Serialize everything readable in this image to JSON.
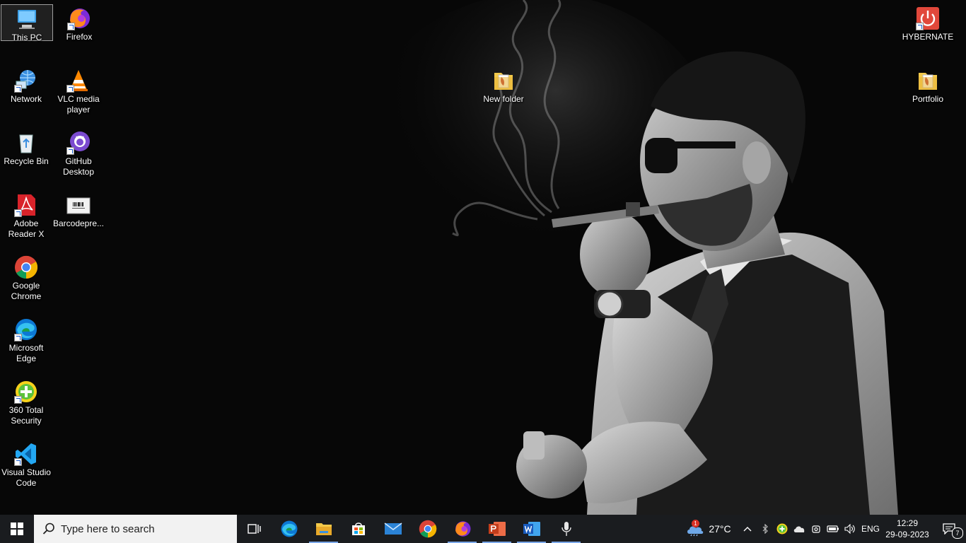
{
  "desktop": {
    "icons_col1": [
      {
        "label": "This PC",
        "icon": "computer-icon"
      },
      {
        "label": "Network",
        "icon": "network-icon"
      },
      {
        "label": "Recycle Bin",
        "icon": "recycle-bin-icon"
      },
      {
        "label": "Adobe Reader X",
        "icon": "adobe-reader-icon"
      },
      {
        "label": "Google Chrome",
        "icon": "chrome-icon"
      },
      {
        "label": "Microsoft Edge",
        "icon": "edge-icon"
      },
      {
        "label": "360 Total Security",
        "icon": "360-security-icon"
      },
      {
        "label": "Visual Studio Code",
        "icon": "vscode-icon"
      }
    ],
    "icons_col2": [
      {
        "label": "Firefox",
        "icon": "firefox-icon"
      },
      {
        "label": "VLC media player",
        "icon": "vlc-icon"
      },
      {
        "label": "GitHub Desktop",
        "icon": "github-desktop-icon"
      },
      {
        "label": "Barcodepre...",
        "icon": "barcode-file-icon"
      }
    ],
    "new_folder": {
      "label": "New folder",
      "icon": "folder-icon"
    },
    "hybernate": {
      "label": "HYBERNATE",
      "icon": "power-icon"
    },
    "portfolio": {
      "label": "Portfolio",
      "icon": "folder-icon"
    }
  },
  "taskbar": {
    "search_placeholder": "Type here to search",
    "apps": [
      "task-view",
      "microsoft-edge",
      "file-explorer",
      "microsoft-store",
      "mail",
      "google-chrome",
      "firefox",
      "powerpoint",
      "word",
      "voice-recorder"
    ],
    "weather": {
      "temp": "27°C",
      "badge": "1"
    },
    "language": "ENG",
    "time": "12:29",
    "date": "29-09-2023",
    "notification_count": "7"
  },
  "colors": {
    "taskbar_bg": "#1a1c1f",
    "accent": "#7aa7e8"
  }
}
